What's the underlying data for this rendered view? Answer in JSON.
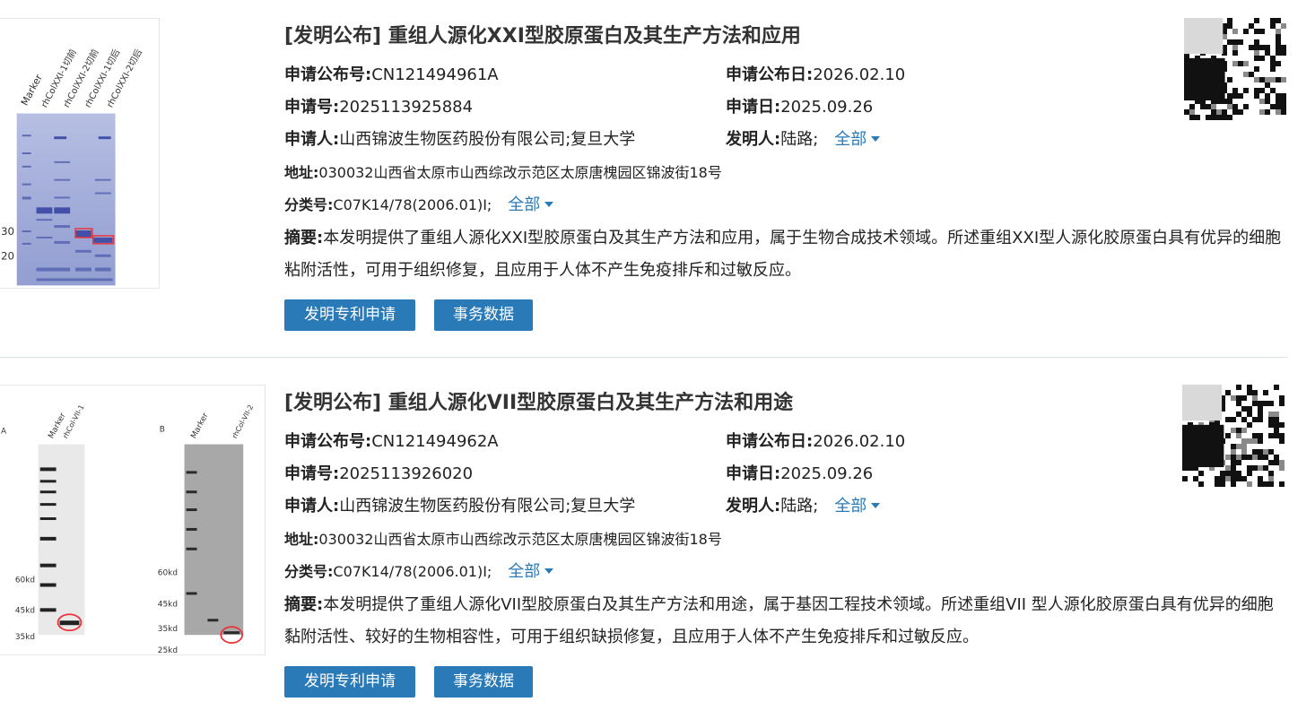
{
  "records": [
    {
      "title": "[发明公布] 重组人源化XXI型胶原蛋白及其生产方法和应用",
      "pub_no_label": "申请公布号:",
      "pub_no": "CN121494961A",
      "pub_date_label": "申请公布日:",
      "pub_date": "2026.02.10",
      "app_no_label": "申请号:",
      "app_no": "2025113925884",
      "app_date_label": "申请日:",
      "app_date": "2025.09.26",
      "applicant_label": "申请人:",
      "applicant": "山西锦波生物医药股份有限公司;复旦大学",
      "inventor_label": "发明人:",
      "inventor": "陆路;",
      "more_label": "全部",
      "address_label": "地址:",
      "address": "030032山西省太原市山西综改示范区太原唐槐园区锦波街18号",
      "class_label": "分类号:",
      "class_value": "C07K14/78(2006.01)I;",
      "abstract_label": "摘要:",
      "abstract": "本发明提供了重组人源化XXI型胶原蛋白及其生产方法和应用，属于生物合成技术领域。所述重组XXI型人源化胶原蛋白具有优异的细胞粘附活性，可用于组织修复，且应用于人体不产生免疫排斥和过敏反应。",
      "btn_apply": "发明专利申请",
      "btn_affairs": "事务数据",
      "figure": {
        "lane_labels": [
          "Marker",
          "rhColXXI-1切前",
          "rhColXXI-2切前",
          "rhColXXI-1切后",
          "rhColXXI-2切后"
        ],
        "marker_labels": [
          "30",
          "20"
        ]
      }
    },
    {
      "title": "[发明公布] 重组人源化VII型胶原蛋白及其生产方法和用途",
      "pub_no_label": "申请公布号:",
      "pub_no": "CN121494962A",
      "pub_date_label": "申请公布日:",
      "pub_date": "2026.02.10",
      "app_no_label": "申请号:",
      "app_no": "2025113926020",
      "app_date_label": "申请日:",
      "app_date": "2025.09.26",
      "applicant_label": "申请人:",
      "applicant": "山西锦波生物医药股份有限公司;复旦大学",
      "inventor_label": "发明人:",
      "inventor": "陆路;",
      "more_label": "全部",
      "address_label": "地址:",
      "address": "030032山西省太原市山西综改示范区太原唐槐园区锦波街18号",
      "class_label": "分类号:",
      "class_value": "C07K14/78(2006.01)I;",
      "abstract_label": "摘要:",
      "abstract": "本发明提供了重组人源化VII型胶原蛋白及其生产方法和用途，属于基因工程技术领域。所述重组VII 型人源化胶原蛋白具有优异的细胞黏附活性、较好的生物相容性，可用于组织缺损修复，且应用于人体不产生免疫排斥和过敏反应。",
      "btn_apply": "发明专利申请",
      "btn_affairs": "事务数据",
      "figure": {
        "panel_a": "A",
        "panel_b": "B",
        "lane_a": [
          "Marker",
          "rhCol-VII-1"
        ],
        "lane_b": [
          "Marker",
          "rhCol-VII-2"
        ],
        "marker_a": [
          "60kd",
          "45kd",
          "35kd"
        ],
        "marker_b": [
          "60kd",
          "45kd",
          "35kd",
          "25kd"
        ]
      }
    }
  ],
  "colors": {
    "accent": "#2a7ab8",
    "gel_blue": "#9aa6d6",
    "highlight": "#e8343a"
  }
}
